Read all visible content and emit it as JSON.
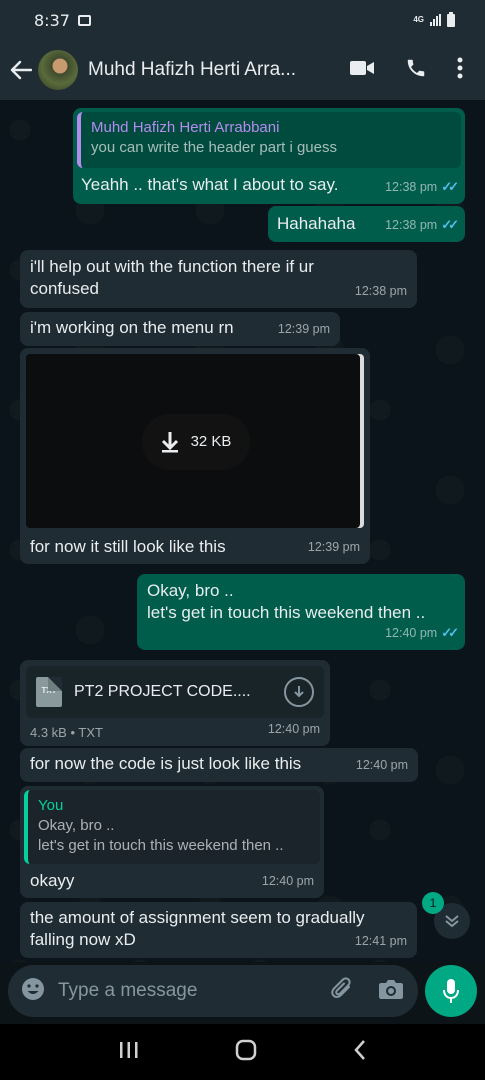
{
  "status_bar": {
    "time": "8:37",
    "network": "4G"
  },
  "header": {
    "contact_name": "Muhd Hafizh Herti Arra..."
  },
  "messages": [
    {
      "quote_name": "Muhd Hafizh Herti Arrabbani",
      "quote_text": "you can write the header part i guess",
      "text": "Yeahh .. that's what I about to say.",
      "time": "12:38 pm"
    },
    {
      "text": "Hahahaha",
      "time": "12:38 pm"
    },
    {
      "text_line1": "i'll help out with the function there if ur",
      "text_line2": "confused",
      "time": "12:38 pm"
    },
    {
      "text": "i'm working on the menu rn",
      "time": "12:39 pm"
    },
    {
      "download_size": "32 KB",
      "caption": "for now it still look like this",
      "time": "12:39 pm"
    },
    {
      "text_line1": "Okay, bro ..",
      "text_line2": "let's get in touch this weekend then ..",
      "time": "12:40 pm"
    },
    {
      "file_type_badge": "TXT",
      "file_name": "PT2 PROJECT CODE....",
      "file_info": "4.3 kB • TXT",
      "time": "12:40 pm"
    },
    {
      "text": "for now the code is just look like this",
      "time": "12:40 pm"
    },
    {
      "quote_name": "You",
      "quote_line1": "Okay, bro ..",
      "quote_line2": "let's get in touch this weekend then ..",
      "text": "okayy",
      "time": "12:40 pm"
    },
    {
      "text_line1": "the amount of assignment seem to gradually",
      "text_line2": "falling now xD",
      "time": "12:41 pm"
    }
  ],
  "unread_count": "1",
  "composer": {
    "placeholder": "Type a message"
  },
  "colors": {
    "outgoing_bubble": "#005c4b",
    "incoming_bubble": "#1f2c33",
    "accent": "#00a884",
    "read_ticks": "#53bdeb"
  }
}
